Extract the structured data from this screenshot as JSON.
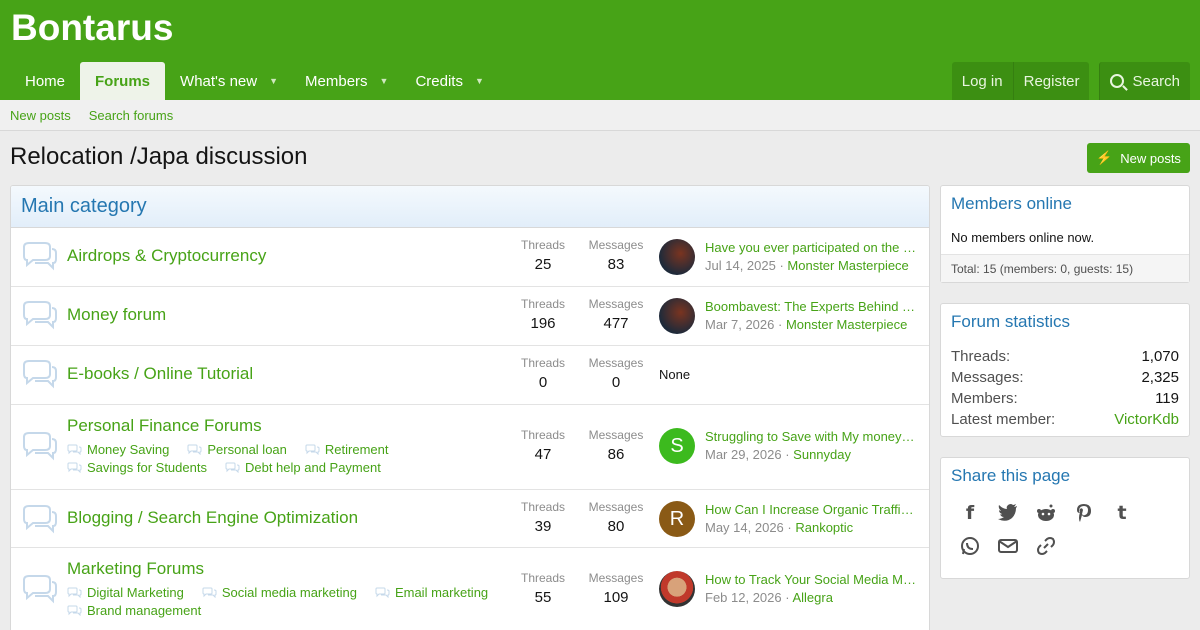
{
  "site": {
    "title": "Bontarus"
  },
  "nav": {
    "tabs": [
      {
        "label": "Home"
      },
      {
        "label": "Forums"
      },
      {
        "label": "What's new"
      },
      {
        "label": "Members"
      },
      {
        "label": "Credits"
      }
    ],
    "login_label": "Log in",
    "register_label": "Register",
    "search_label": "Search"
  },
  "subnav": {
    "new_posts": "New posts",
    "search_forums": "Search forums"
  },
  "page": {
    "title": "Relocation /Japa discussion",
    "new_posts_button": "New posts"
  },
  "category": {
    "title": "Main category",
    "nodes": [
      {
        "title": "Airdrops & Cryptocurrency",
        "threads_label": "Threads",
        "threads": "25",
        "messages_label": "Messages",
        "messages": "83",
        "last_title": "Have you ever participated on the c...",
        "last_date": "Jul 14, 2025",
        "last_user": "Monster Masterpiece"
      },
      {
        "title": "Money forum",
        "threads_label": "Threads",
        "threads": "196",
        "messages_label": "Messages",
        "messages": "477",
        "last_title": "Boombavest: The Experts Behind C...",
        "last_date": "Mar 7, 2026",
        "last_user": "Monster Masterpiece"
      },
      {
        "title": "E-books / Online Tutorial",
        "threads_label": "Threads",
        "threads": "0",
        "messages_label": "Messages",
        "messages": "0",
        "last_none": "None"
      },
      {
        "title": "Personal Finance Forums",
        "subforums": [
          "Money Saving",
          "Personal loan",
          "Retirement",
          "Savings for Students",
          "Debt help and Payment"
        ],
        "threads_label": "Threads",
        "threads": "47",
        "messages_label": "Messages",
        "messages": "86",
        "avatar_letter": "S",
        "last_title": "Struggling to Save with My money w...",
        "last_date": "Mar 29, 2026",
        "last_user": "Sunnyday"
      },
      {
        "title": "Blogging / Search Engine Optimization",
        "threads_label": "Threads",
        "threads": "39",
        "messages_label": "Messages",
        "messages": "80",
        "avatar_letter": "R",
        "last_title": "How Can I Increase Organic Traffic f...",
        "last_date": "May 14, 2026",
        "last_user": "Rankoptic"
      },
      {
        "title": "Marketing Forums",
        "subforums": [
          "Digital Marketing",
          "Social media marketing",
          "Email marketing",
          "Brand management"
        ],
        "threads_label": "Threads",
        "threads": "55",
        "messages_label": "Messages",
        "messages": "109",
        "last_title": "How to Track Your Social Media Ma...",
        "last_date": "Feb 12, 2026",
        "last_user": "Allegra"
      }
    ]
  },
  "sidebar": {
    "members_online": {
      "title": "Members online",
      "text": "No members online now.",
      "total": "Total: 15 (members: 0, guests: 15)"
    },
    "forum_stats": {
      "title": "Forum statistics",
      "rows": [
        {
          "k": "Threads:",
          "v": "1,070"
        },
        {
          "k": "Messages:",
          "v": "2,325"
        },
        {
          "k": "Members:",
          "v": "119"
        },
        {
          "k": "Latest member:",
          "v": "VictorKdb"
        }
      ]
    },
    "share": {
      "title": "Share this page",
      "icons": [
        "facebook-icon",
        "twitter-icon",
        "reddit-icon",
        "pinterest-icon",
        "tumblr-icon",
        "whatsapp-icon",
        "email-icon",
        "link-icon"
      ]
    }
  },
  "colors": {
    "brand": "#47a317",
    "link_blue": "#2577b1",
    "avatar_s": "#3cba1e",
    "avatar_r": "#8a5a16"
  }
}
